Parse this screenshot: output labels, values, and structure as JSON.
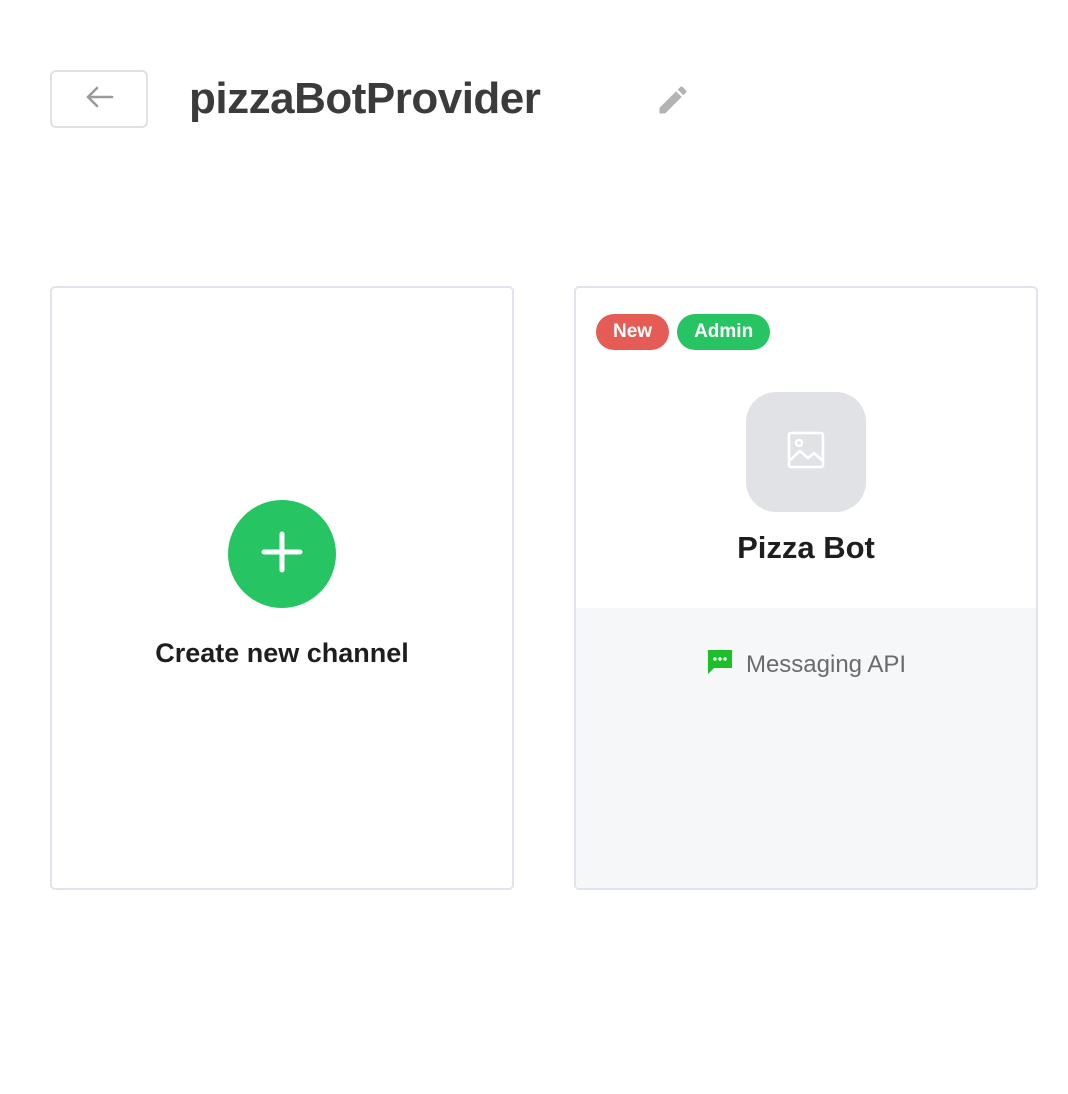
{
  "header": {
    "back_icon": "arrow-left-icon",
    "title": "pizzaBotProvider",
    "edit_icon": "pencil-icon"
  },
  "create_card": {
    "icon": "plus-icon",
    "label": "Create new channel",
    "accent_color": "#27c464"
  },
  "channels": [
    {
      "badges": [
        {
          "label": "New",
          "color": "#e55b56"
        },
        {
          "label": "Admin",
          "color": "#27c464"
        }
      ],
      "avatar_icon": "image-placeholder-icon",
      "name": "Pizza Bot",
      "type_icon": "chat-bubble-icon",
      "type_label": "Messaging API"
    }
  ]
}
